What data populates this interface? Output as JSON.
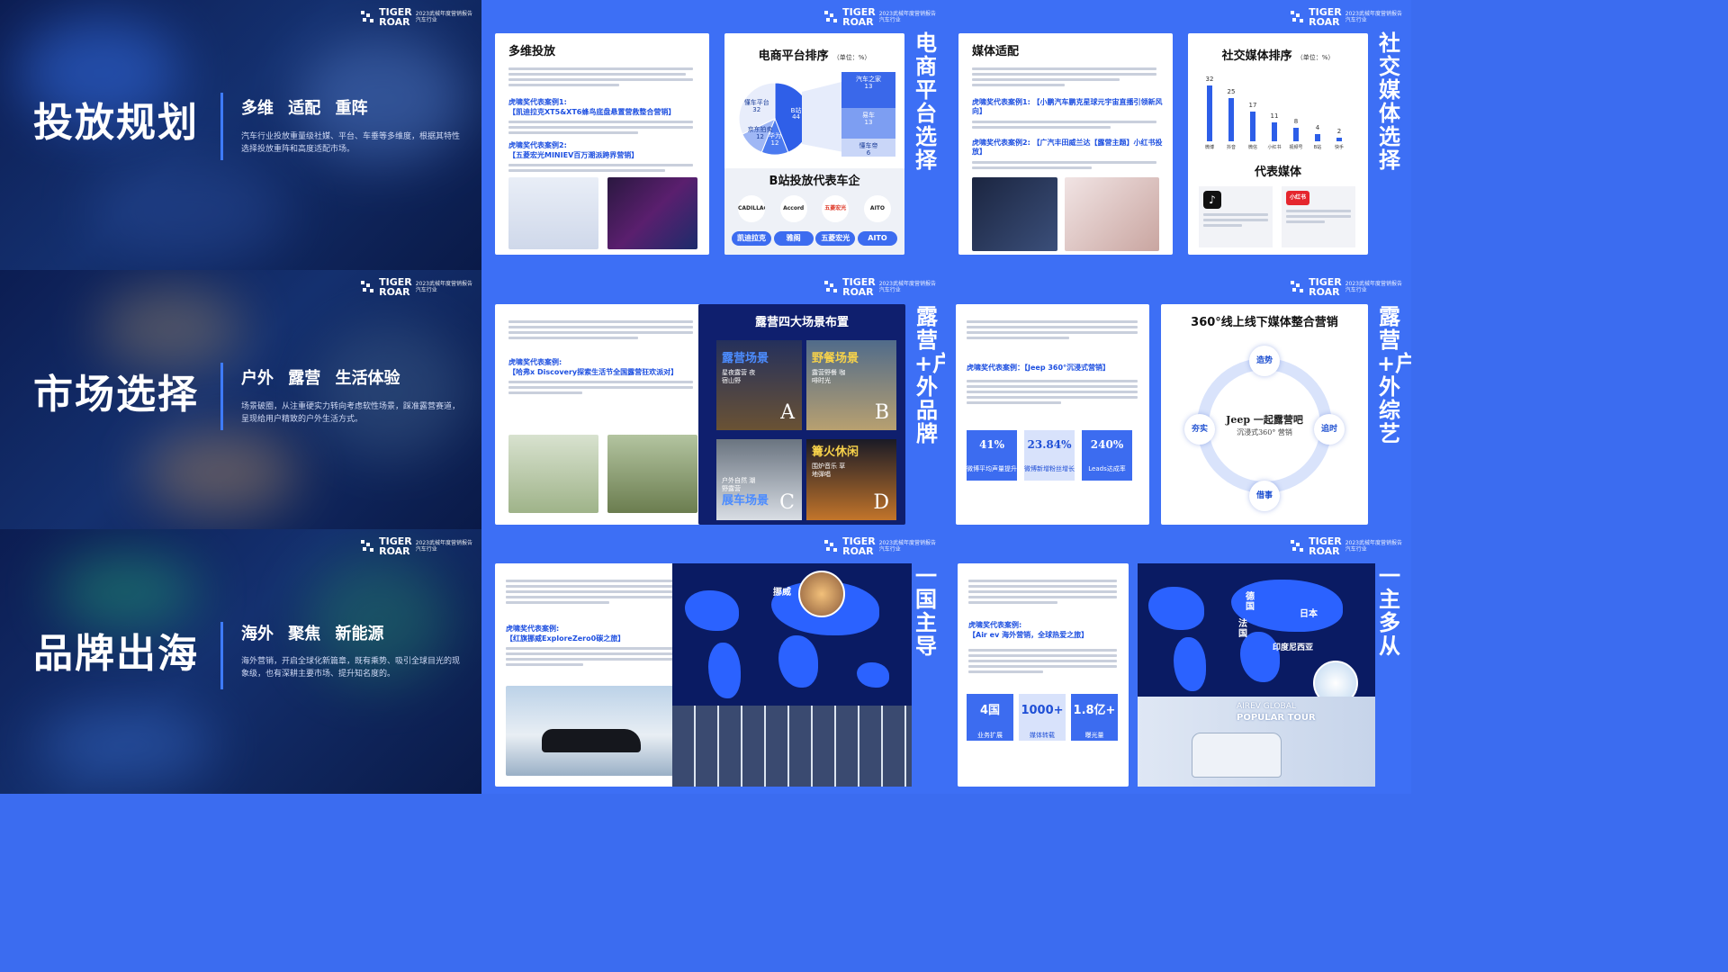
{
  "brand": {
    "logo_top": "TIGER",
    "logo_bottom": "ROAR",
    "sub_1": "2023武械年度营销报告",
    "sub_2": "汽车行业"
  },
  "sections": {
    "s1": {
      "title": "投放规划",
      "keywords": "多维 适配 重阵",
      "desc": "汽车行业投放重量级社媒、平台、车垂等多维度，根据其特性选择投放重阵和高度适配市场。"
    },
    "s2": {
      "title": "市场选择",
      "keywords": "户外 露营 生活体验",
      "desc": "场景破圈，从注重硬实力转向考虑软性场景，踩准露营赛道，呈现给用户精致的户外生活方式。"
    },
    "s3": {
      "title": "品牌出海",
      "keywords": "海外 聚焦 新能源",
      "desc": "海外营销，开启全球化新篇章，既有乘势、吸引全球目光的现象级，也有深耕主要市场、提升知名度的。"
    }
  },
  "vertical_titles": {
    "ecommerce": "电商平台选择",
    "social": "社交媒体选择",
    "camping_brand": "露营+户外品牌",
    "camping_variety": "露营+户外综艺",
    "one_lead": "一国主导",
    "multi": "一主多从"
  },
  "row1": {
    "multi_title": "多维投放",
    "multi_case1": "虎啸奖代表案例1:",
    "multi_case1_name": "【凯迪拉克XT5&XT6蜂鸟底盘悬置营救整合营销】",
    "multi_case2": "虎啸奖代表案例2:",
    "multi_case2_name": "【五菱宏光MINIEV百万潮派跨界营销】",
    "ecom_title": "电商平台排序",
    "ecom_unit": "（单位：%）",
    "pie": [
      {
        "label": "B站",
        "value": 44
      },
      {
        "label": "华为",
        "value": 12
      },
      {
        "label": "京东拍卖",
        "value": 12
      },
      {
        "label": "懂车平台",
        "value": 32
      }
    ],
    "ecom_side": [
      {
        "label": "汽车之家",
        "value": "13"
      },
      {
        "label": "易车",
        "value": "13"
      },
      {
        "label": "懂车帝",
        "value": "6"
      }
    ],
    "bili_title": "B站投放代表车企",
    "car_brands": [
      {
        "logo": "CADILLAC",
        "pill": "凯迪拉克"
      },
      {
        "logo": "Accord",
        "pill": "雅阁"
      },
      {
        "logo": "五菱宏光",
        "pill": "五菱宏光"
      },
      {
        "logo": "AITO",
        "pill": "AITO"
      }
    ],
    "media_title": "媒体适配",
    "media_case1": "虎啸奖代表案例1: 【小鹏汽车鹏克星球元宇宙直播引领新风向】",
    "media_case2": "虎啸奖代表案例2: 【广汽丰田威兰达【露营主题】小红书投放】",
    "social_title": "社交媒体排序",
    "social_unit": "（单位：%）",
    "social_bars": [
      {
        "name": "微博",
        "value": 32
      },
      {
        "name": "抖音",
        "value": 25
      },
      {
        "name": "微信",
        "value": 17
      },
      {
        "name": "小红书",
        "value": 11
      },
      {
        "name": "视频号",
        "value": 8
      },
      {
        "name": "B站",
        "value": 4
      },
      {
        "name": "快手",
        "value": 2
      }
    ],
    "rep_media": "代表媒体",
    "rep_douyin": "抖音",
    "rep_xhs": "小红书"
  },
  "row2": {
    "case_label": "虎啸奖代表案例:",
    "case_name": "【哈弗x Discovery探索生活节全国露营狂欢派对】",
    "scene_title": "露营四大场景布置",
    "scenes": [
      {
        "name": "露营场景",
        "sub": "星夜露营 夜宿山野",
        "letter": "A"
      },
      {
        "name": "野餐场景",
        "sub": "露营野餐 咖啡时光",
        "letter": "B"
      },
      {
        "name": "展车场景",
        "sub": "户外自然 潮野露营",
        "letter": "C"
      },
      {
        "name": "篝火休闲",
        "sub": "围炉音乐 草地弹唱",
        "letter": "D"
      }
    ],
    "jeep_case": "虎啸奖代表案例：【Jeep 360°沉浸式营销】",
    "jeep_stats": [
      {
        "value": "41%",
        "label": "微博平均声量提升"
      },
      {
        "value": "23.84%",
        "label": "微博新增粉丝增长"
      },
      {
        "value": "240%",
        "label": "Leads达成率"
      }
    ],
    "ring_title": "360°线上线下媒体整合营销",
    "ring_center_1": "Jeep 一起露营吧",
    "ring_center_2": "沉浸式360° 营销",
    "ring_nodes": {
      "top": "造势",
      "left": "夯实",
      "right": "追时",
      "bottom": "借事"
    }
  },
  "row3": {
    "case_label": "虎啸奖代表案例:",
    "case_name": "【红旗挪威ExploreZero0碳之旅】",
    "country": "挪威",
    "case2_label": "虎啸奖代表案例:",
    "case2_name": "【Air ev 海外营销，全球热爱之旅】",
    "stats": [
      {
        "value": "4国",
        "label": "业务扩展"
      },
      {
        "value": "1000+",
        "label": "媒体转载"
      },
      {
        "value": "1.8亿+",
        "label": "曝光量"
      }
    ],
    "countries": [
      "德国",
      "法国",
      "日本",
      "印度尼西亚"
    ],
    "tour_1": "AIREV GLOBAL",
    "tour_2": "POPULAR TOUR"
  }
}
